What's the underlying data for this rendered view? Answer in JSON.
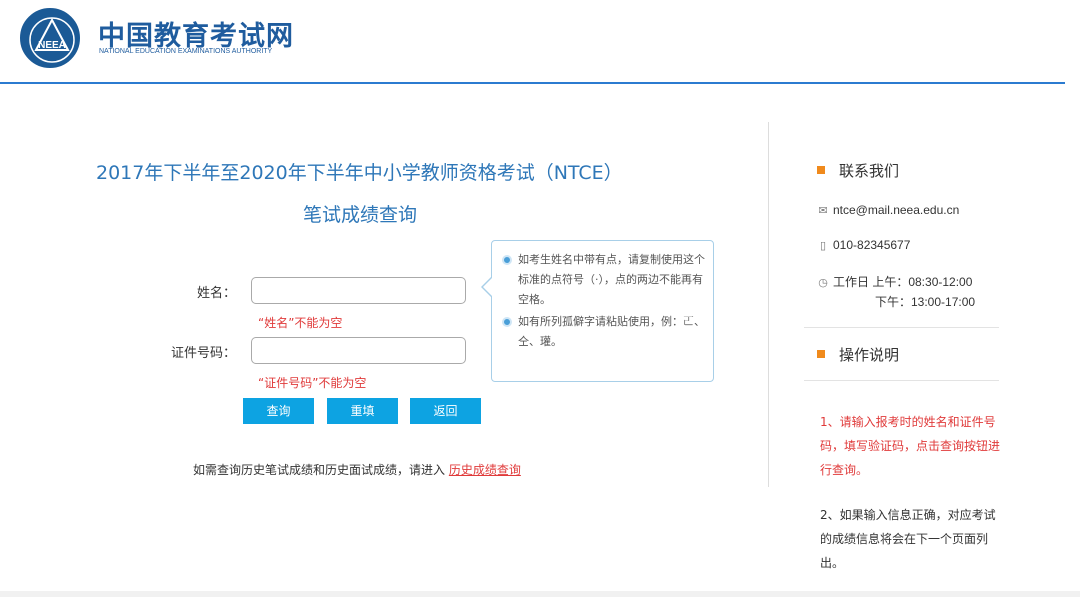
{
  "header": {
    "logo_cn": "中国教育考试网",
    "logo_en": "NATIONAL EDUCATION EXAMINATIONS AUTHORITY",
    "logo_mark": "NEEA"
  },
  "main": {
    "title_line1": "2017年下半年至2020年下半年中小学教师资格考试（NTCE）",
    "title_line2": "笔试成绩查询",
    "form": {
      "name_label": "姓名：",
      "name_value": "",
      "name_error": "“姓名”不能为空",
      "id_label": "证件号码：",
      "id_value": "",
      "id_error": "“证件号码”不能为空"
    },
    "buttons": {
      "query": "查询",
      "reset": "重填",
      "back": "返回"
    },
    "history_text": "如需查询历史笔试成绩和历史面试成绩，请进入",
    "history_link": "历史成绩查询"
  },
  "tip": {
    "item1": "如考生姓名中带有点，请复制使用这个标准的点符号（·），点的两边不能再有空格。",
    "item2": "如有所列孤僻字请粘贴使用，例：𠀀、仝、瓘。"
  },
  "sidebar": {
    "contact_title": "联系我们",
    "email": "ntce@mail.neea.edu.cn",
    "phone": "010-82345677",
    "time_line1": "工作日 上午：08:30-12:00",
    "time_line2": "下午：13:00-17:00",
    "ops_title": "操作说明",
    "ops_item1": "1、请输入报考时的姓名和证件号码，填写验证码，点击查询按钮进行查询。",
    "ops_item2": "2、如果输入信息正确，对应考试的成绩信息将会在下一个页面列出。"
  },
  "colors": {
    "brand_blue": "#1f5c9e",
    "title_blue": "#2e77b8",
    "button_blue": "#0da3e2",
    "error_red": "#e03a3a",
    "accent_orange": "#f08a1c"
  },
  "icons": {
    "email": "mail-icon",
    "phone": "phone-icon",
    "time": "clock-icon"
  }
}
